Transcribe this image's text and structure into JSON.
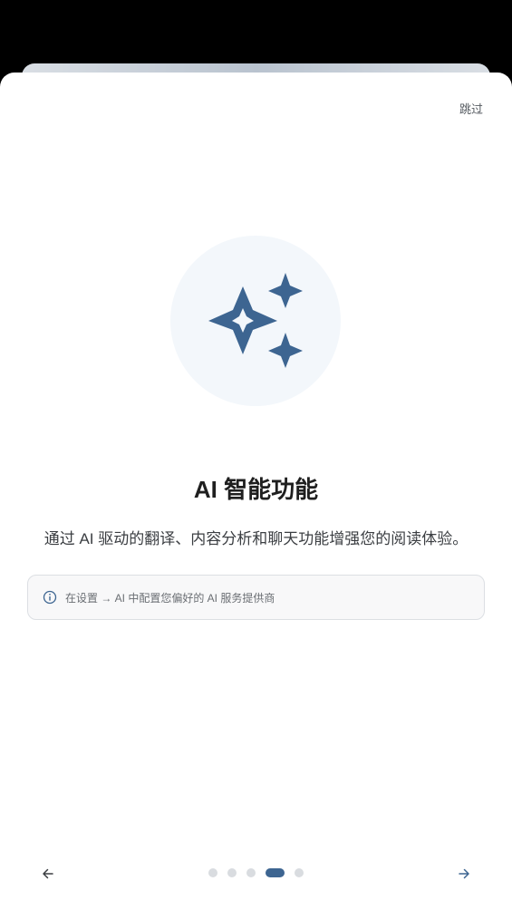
{
  "header": {
    "skip_label": "跳过"
  },
  "hero": {
    "icon": "sparkles-icon",
    "accent_color": "#3d6591",
    "circle_color": "#f3f7fb"
  },
  "content": {
    "title": "AI 智能功能",
    "description": "通过 AI 驱动的翻译、内容分析和聊天功能增强您的阅读体验。",
    "info_icon": "info-icon",
    "info_text": "在设置 → AI 中配置您偏好的 AI 服务提供商"
  },
  "pager": {
    "total_pages": 5,
    "current_page": 4,
    "prev_icon": "arrow-left-icon",
    "next_icon": "arrow-right-icon"
  }
}
